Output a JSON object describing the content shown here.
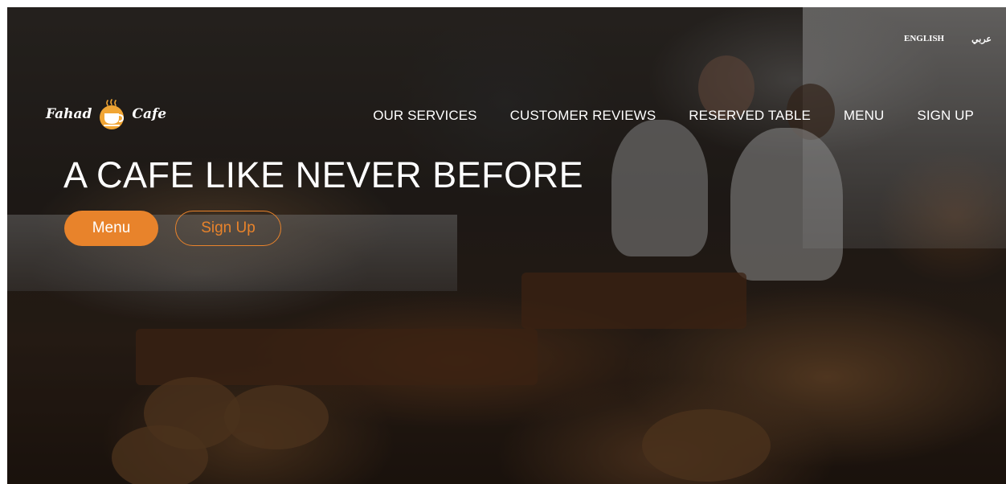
{
  "language_switcher": {
    "english_label": "ENGLISH",
    "arabic_label": "عربي"
  },
  "logo": {
    "left_text": "Fahad",
    "right_text": "Cafe",
    "icon": "coffee-cup-icon",
    "icon_color": "#f0a534"
  },
  "nav": {
    "items": [
      {
        "label": "OUR SERVICES"
      },
      {
        "label": "CUSTOMER REVIEWS"
      },
      {
        "label": "RESERVED TABLE"
      },
      {
        "label": "MENU"
      },
      {
        "label": "SIGN UP"
      }
    ]
  },
  "hero": {
    "title": "A CAFE LIKE NEVER BEFORE",
    "primary_button": "Menu",
    "secondary_button": "Sign Up"
  },
  "colors": {
    "accent": "#e8832b",
    "text": "#ffffff"
  }
}
